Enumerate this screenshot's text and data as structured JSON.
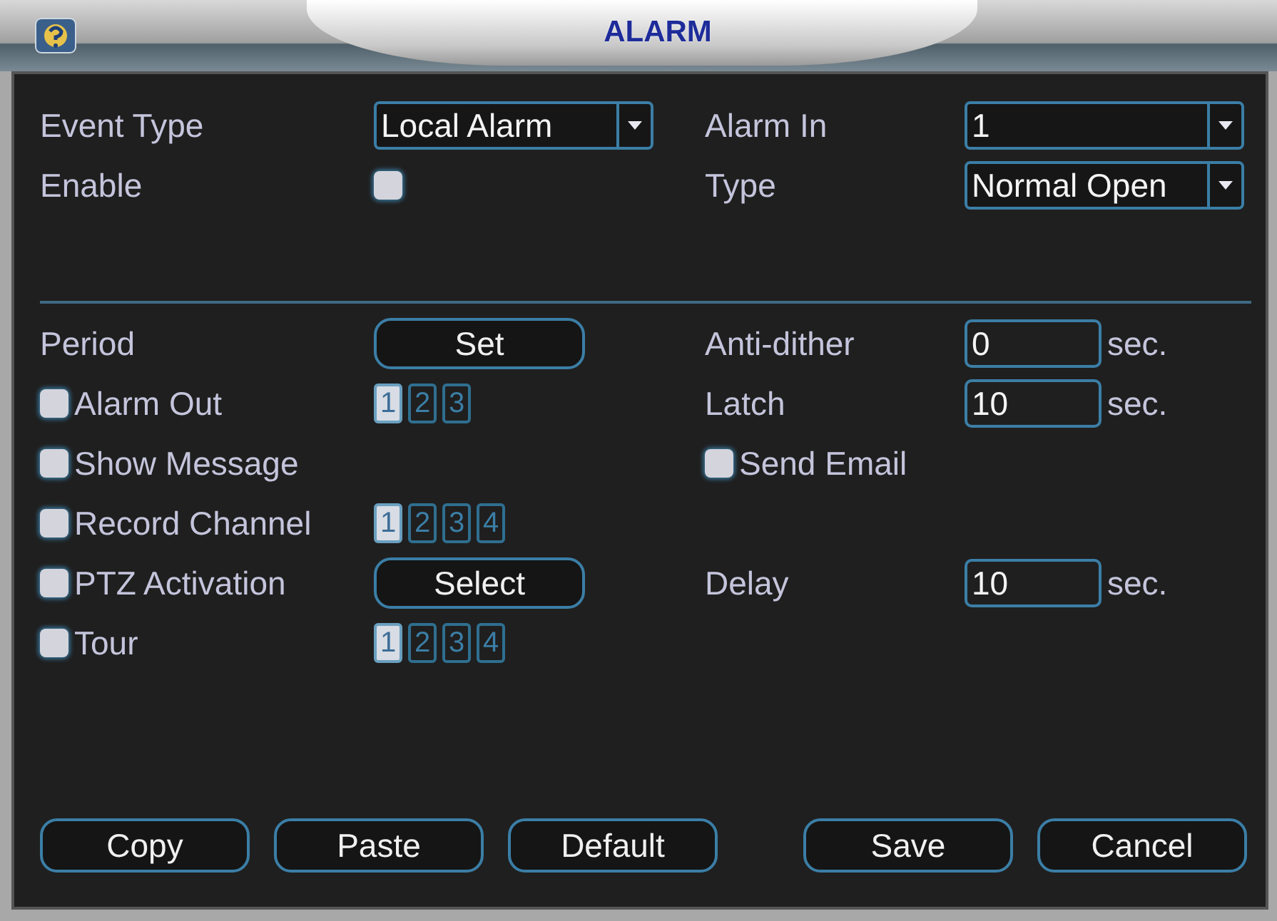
{
  "window": {
    "title": "ALARM"
  },
  "sections": [
    {
      "rows": [
        {
          "left": {
            "kind": "label",
            "text": "Event Type"
          },
          "middle": {
            "kind": "dropdown",
            "value": "Local Alarm"
          },
          "right": {
            "kind": "label",
            "text": "Alarm In"
          },
          "far_right": {
            "kind": "dropdown",
            "value": "1"
          }
        },
        {
          "left": {
            "kind": "label",
            "text": "Enable"
          },
          "middle": {
            "kind": "checkbox",
            "checked": false
          },
          "right": {
            "kind": "label",
            "text": "Type"
          },
          "far_right": {
            "kind": "dropdown",
            "value": "Normal Open"
          }
        }
      ]
    },
    {
      "rows": [
        {
          "left": {
            "kind": "label",
            "text": "Period"
          },
          "middle": {
            "kind": "button",
            "label": "Set"
          },
          "right": {
            "kind": "label",
            "text": "Anti-dither"
          },
          "far_right": {
            "kind": "number",
            "value": "0",
            "unit": "sec."
          }
        },
        {
          "left": {
            "kind": "checkbox",
            "label": "Alarm Out",
            "checked": false
          },
          "middle": {
            "kind": "channels",
            "items": [
              {
                "label": "1",
                "selected": true
              },
              {
                "label": "2",
                "selected": false
              },
              {
                "label": "3",
                "selected": false
              }
            ]
          },
          "right": {
            "kind": "label",
            "text": "Latch"
          },
          "far_right": {
            "kind": "number",
            "value": "10",
            "unit": "sec."
          }
        },
        {
          "left": {
            "kind": "checkbox",
            "label": "Show Message",
            "checked": false
          },
          "right": {
            "kind": "checkbox",
            "label": "Send Email",
            "checked": false
          }
        },
        {
          "left": {
            "kind": "checkbox",
            "label": "Record Channel",
            "checked": false
          },
          "middle": {
            "kind": "channels",
            "items": [
              {
                "label": "1",
                "selected": true
              },
              {
                "label": "2",
                "selected": false
              },
              {
                "label": "3",
                "selected": false
              },
              {
                "label": "4",
                "selected": false
              }
            ]
          }
        },
        {
          "left": {
            "kind": "checkbox",
            "label": "PTZ Activation",
            "checked": false
          },
          "middle": {
            "kind": "button",
            "label": "Select"
          },
          "right": {
            "kind": "label",
            "text": "Delay"
          },
          "far_right": {
            "kind": "number",
            "value": "10",
            "unit": "sec."
          }
        },
        {
          "left": {
            "kind": "checkbox",
            "label": "Tour",
            "checked": false
          },
          "middle": {
            "kind": "channels",
            "items": [
              {
                "label": "1",
                "selected": true
              },
              {
                "label": "2",
                "selected": false
              },
              {
                "label": "3",
                "selected": false
              },
              {
                "label": "4",
                "selected": false
              }
            ]
          }
        }
      ]
    }
  ],
  "buttons_left": [
    {
      "label": "Copy"
    },
    {
      "label": "Paste"
    },
    {
      "label": "Default"
    }
  ],
  "buttons_right": [
    {
      "label": "Save"
    },
    {
      "label": "Cancel"
    }
  ]
}
